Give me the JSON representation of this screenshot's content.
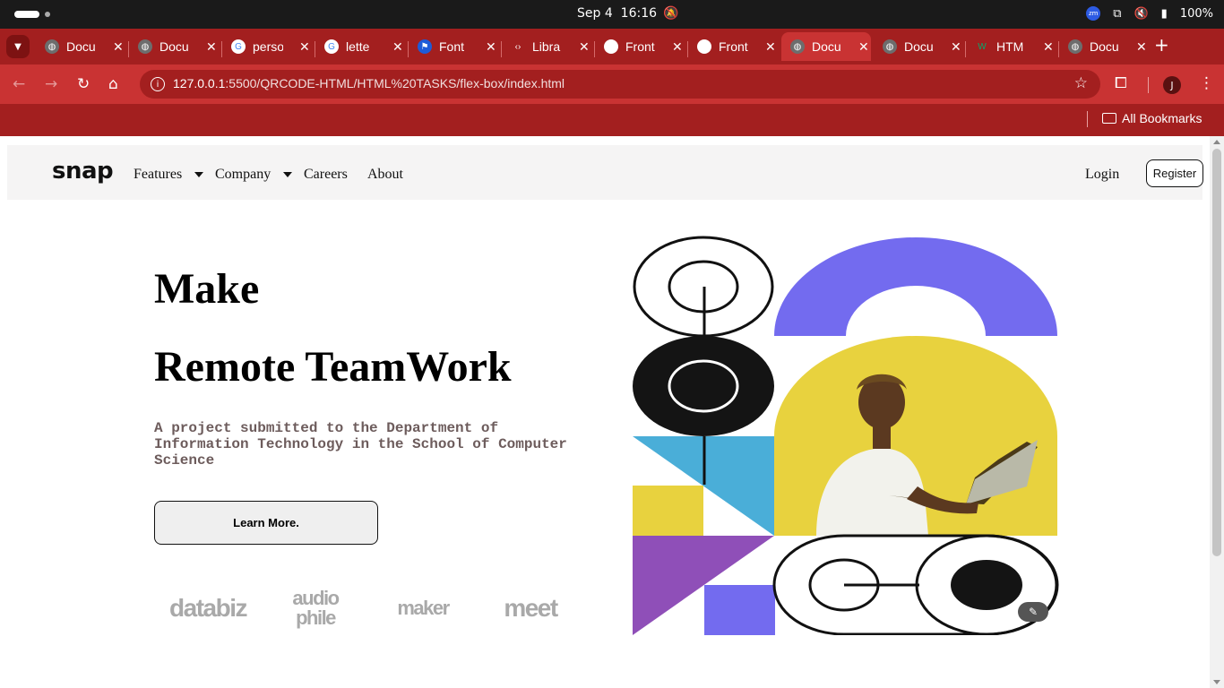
{
  "os": {
    "date": "Sep 4",
    "time": "16:16",
    "zoom_badge": "zm",
    "battery": "100%"
  },
  "tabs": [
    {
      "label": "Docu",
      "icon": "globe-icon"
    },
    {
      "label": "Docu",
      "icon": "globe-icon"
    },
    {
      "label": "perso",
      "icon": "google-icon"
    },
    {
      "label": "lette",
      "icon": "google-icon"
    },
    {
      "label": "Font",
      "icon": "flag-icon"
    },
    {
      "label": "Libra",
      "icon": "code-icon"
    },
    {
      "label": "Front",
      "icon": "circle-icon"
    },
    {
      "label": "Front",
      "icon": "page-icon"
    },
    {
      "label": "Docu",
      "icon": "globe-icon",
      "active": true
    },
    {
      "label": "Docu",
      "icon": "globe-icon"
    },
    {
      "label": "HTM",
      "icon": "w3-icon"
    },
    {
      "label": "Docu",
      "icon": "globe-icon"
    }
  ],
  "address": {
    "host": "127.0.0.1",
    "path": ":5500/QRCODE-HTML/HTML%20TASKS/flex-box/index.html"
  },
  "profile_initial": "J",
  "bookmarks": {
    "all_label": "All Bookmarks"
  },
  "site": {
    "logo": "snap",
    "nav": {
      "features": "Features",
      "company": "Company",
      "careers": "Careers",
      "about": "About",
      "login": "Login",
      "register": "Register"
    },
    "hero": {
      "title_line1": "Make",
      "title_line2": "Remote TeamWork",
      "description": "A project submitted to the Department of Information Technology in the School of Computer Science",
      "cta": "Learn More."
    },
    "clients": [
      "databiz",
      "audio phile",
      "maker",
      "meet"
    ]
  },
  "colors": {
    "browser_dark": "#a31f1f",
    "browser_mid": "#c93333",
    "purple_accent": "#736bef",
    "yellow": "#e8d23e",
    "sky_blue": "#4aaed8",
    "violet": "#8f4fb8",
    "muted_text": "#6d5c5c"
  }
}
